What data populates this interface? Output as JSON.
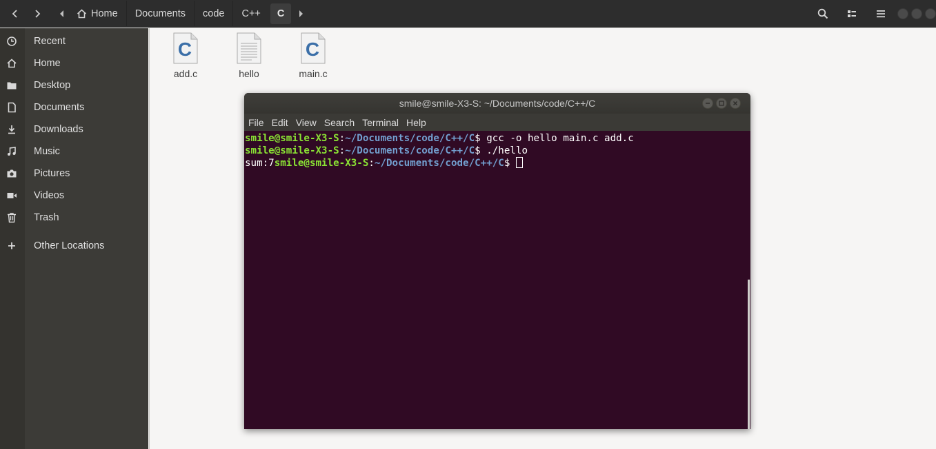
{
  "header": {
    "breadcrumbs": [
      "Home",
      "Documents",
      "code",
      "C++",
      "C"
    ],
    "active_crumb": "C"
  },
  "sidebar": {
    "items": [
      {
        "label": "Recent",
        "icon": "clock-icon"
      },
      {
        "label": "Home",
        "icon": "home-icon"
      },
      {
        "label": "Desktop",
        "icon": "folder-icon"
      },
      {
        "label": "Documents",
        "icon": "document-icon"
      },
      {
        "label": "Downloads",
        "icon": "download-icon"
      },
      {
        "label": "Music",
        "icon": "music-icon"
      },
      {
        "label": "Pictures",
        "icon": "camera-icon"
      },
      {
        "label": "Videos",
        "icon": "video-icon"
      },
      {
        "label": "Trash",
        "icon": "trash-icon"
      },
      {
        "label": "Other Locations",
        "icon": "plus-icon"
      }
    ]
  },
  "files": [
    {
      "name": "add.c",
      "type": "c-source"
    },
    {
      "name": "hello",
      "type": "executable"
    },
    {
      "name": "main.c",
      "type": "c-source"
    }
  ],
  "terminal": {
    "title": "smile@smile-X3-S: ~/Documents/code/C++/C",
    "menu": [
      "File",
      "Edit",
      "View",
      "Search",
      "Terminal",
      "Help"
    ],
    "prompt_user": "smile@smile-X3-S",
    "prompt_path": "~/Documents/code/C++/C",
    "lines": [
      {
        "prefix": "",
        "command": " gcc -o hello main.c add.c"
      },
      {
        "prefix": "",
        "command": " ./hello"
      },
      {
        "prefix": "sum:7",
        "command": " "
      }
    ]
  },
  "colors": {
    "terminal_bg": "#300a24",
    "prompt_user": "#8ae234",
    "prompt_path": "#729fcf",
    "sidebar_bg": "#3c3b37",
    "headerbar_bg": "#2d2d2d"
  }
}
